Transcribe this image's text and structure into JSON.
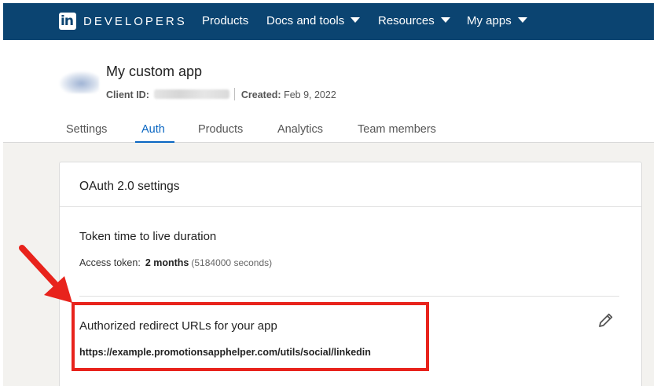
{
  "topnav": {
    "brand_logo": "in",
    "brand_text": "DEVELOPERS",
    "items": [
      {
        "label": "Products",
        "has_dropdown": false
      },
      {
        "label": "Docs and tools",
        "has_dropdown": true
      },
      {
        "label": "Resources",
        "has_dropdown": true
      },
      {
        "label": "My apps",
        "has_dropdown": true
      }
    ]
  },
  "app": {
    "name": "My custom app",
    "client_id_label": "Client ID:",
    "created_label": "Created:",
    "created_value": "Feb 9, 2022"
  },
  "tabs": [
    {
      "label": "Settings",
      "active": false
    },
    {
      "label": "Auth",
      "active": true
    },
    {
      "label": "Products",
      "active": false
    },
    {
      "label": "Analytics",
      "active": false
    },
    {
      "label": "Team members",
      "active": false
    }
  ],
  "oauth": {
    "card_title": "OAuth 2.0 settings",
    "token_section_title": "Token time to live duration",
    "access_token_label": "Access token:",
    "access_token_value": "2 months",
    "access_token_seconds": "(5184000 seconds)",
    "redirect_section_title": "Authorized redirect URLs for your app",
    "redirect_url": "https://example.promotionsapphelper.com/utils/social/linkedin"
  },
  "icons": {
    "edit": "pencil-icon",
    "arrow": "red-arrow-icon"
  },
  "colors": {
    "nav_bg": "#0b4471",
    "accent": "#0a66c2",
    "annotation": "#e8231c"
  }
}
